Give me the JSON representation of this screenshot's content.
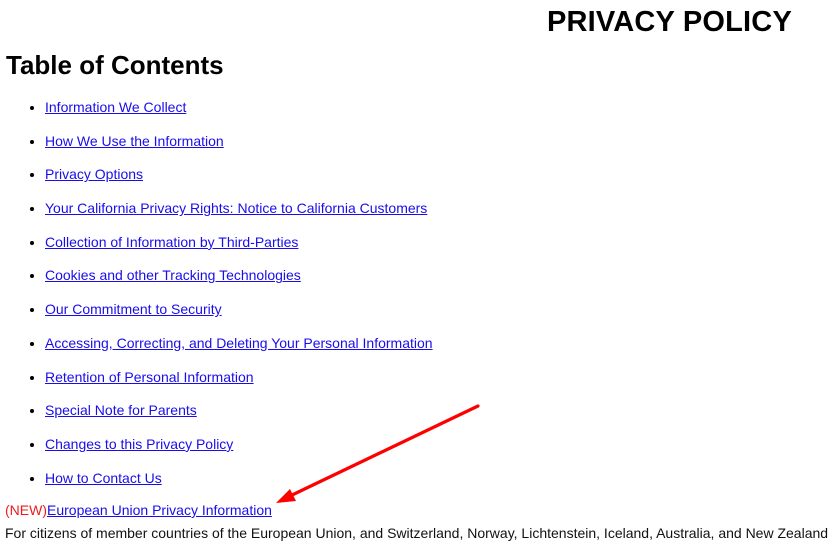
{
  "page": {
    "title": "PRIVACY POLICY"
  },
  "toc": {
    "heading": "Table of Contents",
    "items": [
      {
        "label": "Information We Collect"
      },
      {
        "label": "How We Use the Information"
      },
      {
        "label": "Privacy Options"
      },
      {
        "label": "Your California Privacy Rights: Notice to California Customers"
      },
      {
        "label": "Collection of Information by Third-Parties"
      },
      {
        "label": "Cookies and other Tracking Technologies"
      },
      {
        "label": "Our Commitment to Security"
      },
      {
        "label": "Accessing, Correcting, and Deleting Your Personal Information"
      },
      {
        "label": "Retention of Personal Information"
      },
      {
        "label": "Special Note for Parents"
      },
      {
        "label": "Changes to this Privacy Policy"
      },
      {
        "label": "How to Contact Us"
      }
    ]
  },
  "eu_section": {
    "new_tag": "(NEW)",
    "link_label": "European Union Privacy Information",
    "description": "For citizens of member countries of the European Union, and Switzerland, Norway, Lichtenstein, Iceland, Australia, and New Zealand"
  },
  "annotation": {
    "arrow_icon": "red-arrow-icon",
    "color": "#ff0000"
  },
  "colors": {
    "link": "#1a0dea",
    "new_tag": "#ee1c1c",
    "text": "#000000"
  }
}
